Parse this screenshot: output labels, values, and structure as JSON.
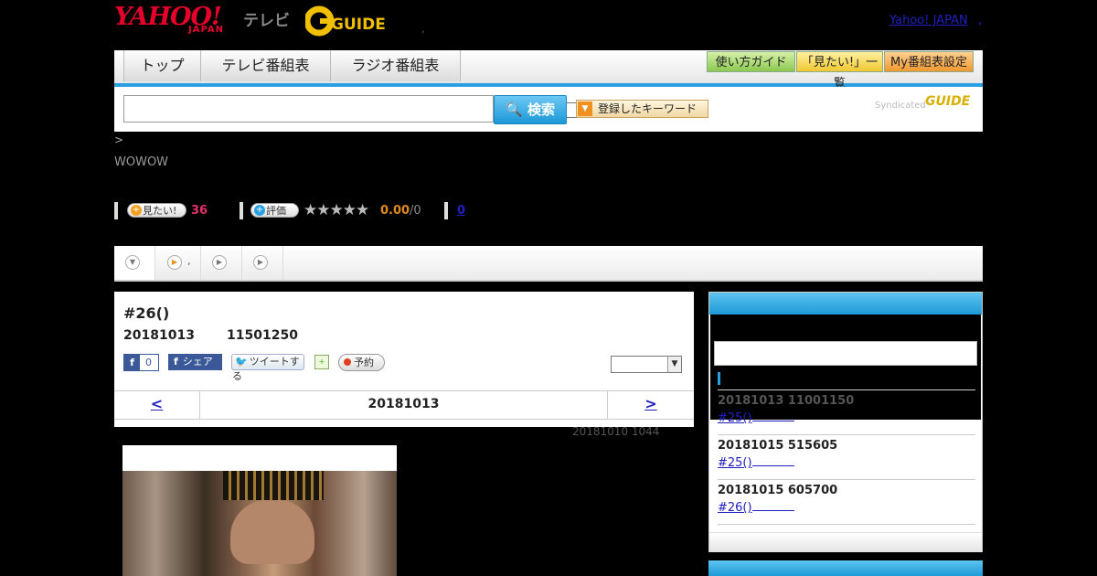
{
  "header": {
    "brand_main": "YAHOO!",
    "brand_sub": "JAPAN",
    "brand_tv": "テレビ",
    "gguide_logo": "GUIDE",
    "sep_dot": ",",
    "yahoo_japan_link": "Yahoo! JAPAN",
    "yahoo_japan_dot": ","
  },
  "nav": {
    "tabs": [
      {
        "label": "トップ"
      },
      {
        "label": "テレビ番組表"
      },
      {
        "label": "ラジオ番組表"
      }
    ],
    "buttons": [
      {
        "label": "使い方ガイド",
        "color": "#a8d870"
      },
      {
        "label": "「見たい!」一覧",
        "color": "#f8d860"
      },
      {
        "label": "My番組表設定",
        "color": "#f0a040"
      }
    ]
  },
  "search": {
    "input_value": "",
    "select_value": "",
    "search_button": "検索",
    "keyword_button": "登録したキーワード",
    "syndicated_label": "Syndicated",
    "syndicated_logo": "GUIDE"
  },
  "breadcrumb": ">",
  "channel": "WOWOW",
  "stats": {
    "miru_button": "見たい!",
    "miru_count": "36",
    "rate_button": "評価",
    "stars": "★★★★★",
    "rating": "0.00",
    "rating_den": "/0",
    "review_count": "0"
  },
  "tabs": [
    {
      "icon": "chevron-down-icon",
      "label": ""
    },
    {
      "icon": "play-icon",
      "label": ","
    },
    {
      "icon": "play-icon",
      "label": ""
    },
    {
      "icon": "play-icon",
      "label": ""
    }
  ],
  "program": {
    "title": "#26()",
    "date": "20181013",
    "time": "11501250",
    "fb_like_count": "0",
    "fb_share": "シェア",
    "tweet": "ツイートする",
    "reserve": "予約",
    "select_value": "",
    "prev": "<",
    "current_date": "20181013",
    "next": ">",
    "updated": "20181010  1044"
  },
  "sidebar": {
    "items": [
      {
        "date": "20181013  11001150",
        "title": "#25()"
      },
      {
        "date": "20181015  515605",
        "title": "#25()"
      },
      {
        "date": "20181015  605700",
        "title": "#26()"
      }
    ]
  }
}
